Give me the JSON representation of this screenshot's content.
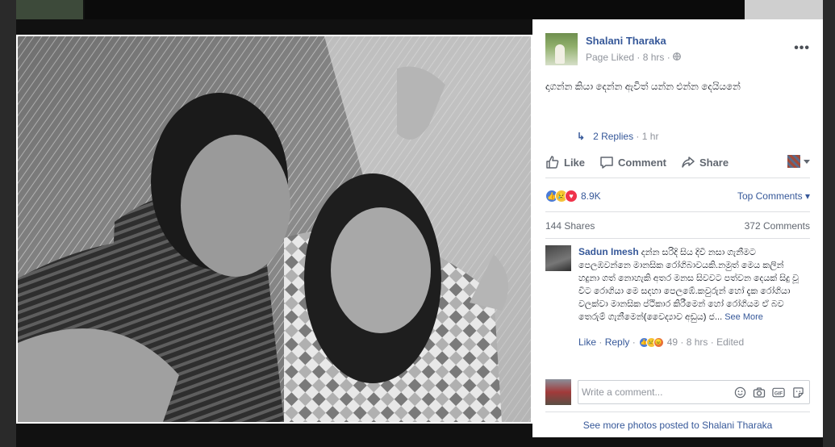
{
  "poster": {
    "name": "Shalani Tharaka",
    "status": "Page Liked",
    "time": "8 hrs"
  },
  "post": {
    "text": "දාගන්න කියා දෙන්න ඇවිත් යන්න එන්න දෙයියනේ"
  },
  "actions": {
    "like": "Like",
    "comment": "Comment",
    "share": "Share"
  },
  "reactions": {
    "count": "8.9K",
    "top_comments": "Top Comments"
  },
  "stats": {
    "shares": "144 Shares",
    "comments": "372 Comments"
  },
  "comment": {
    "author": "Sadun Imesh",
    "text": "දන්න සරිදි සිය දිවි නසා ගැනීමට පෙලඹවන්නෙ මානසික රෝගිබාවයකි.නමුත් මෙය කලින් හදුනා ගත් නොහැකි අතර මනස සිවවට පත්වන දෙයක් සිදු වූ විට රොගියා මෙ සදහා පෙලඹේ.කවුරුන් හෝ දැක රෝගියා වලක්වා මානසික ප්ථිකාර කිරීමෙන් හෝ රෝගියම ඒ බව තෙරුම් ගැනීමෙන්(වෛද්‍යාව අඩුය) ජ...",
    "see_more": "See More",
    "like": "Like",
    "reply": "Reply",
    "reaction_count": "49",
    "time": "8 hrs",
    "edited": "Edited",
    "replies": "2 Replies",
    "replies_time": "1 hr"
  },
  "composer": {
    "placeholder": "Write a comment..."
  },
  "footer": {
    "see_photos": "See more photos posted to Shalani Tharaka"
  },
  "colors": {
    "link": "#365899",
    "muted": "#90949c",
    "like_blue": "#4a7bd8",
    "love_red": "#f0334b",
    "sad_yellow": "#f5c33b"
  }
}
